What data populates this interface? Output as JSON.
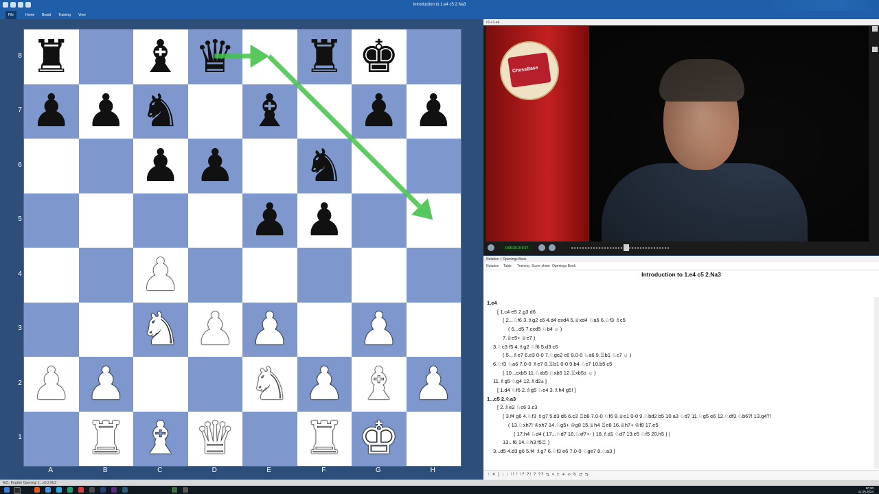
{
  "window": {
    "title": "Introduction to 1.e4 c5 2.Na3"
  },
  "menu": {
    "file": "File",
    "home": "Home",
    "board": "Board",
    "training": "Training",
    "view": "View"
  },
  "board": {
    "ranks": [
      "8",
      "7",
      "6",
      "5",
      "4",
      "3",
      "2",
      "1"
    ],
    "files": [
      "A",
      "B",
      "C",
      "D",
      "E",
      "F",
      "G",
      "H"
    ],
    "position": [
      [
        "r",
        "",
        "b",
        "q",
        "",
        "r",
        "k",
        ""
      ],
      [
        "p",
        "p",
        "n",
        "",
        "b",
        "",
        "p",
        "p"
      ],
      [
        "",
        "",
        "p",
        "p",
        "",
        "n",
        "",
        ""
      ],
      [
        "",
        "",
        "",
        "",
        "p",
        "p",
        "",
        ""
      ],
      [
        "",
        "",
        "P",
        "",
        "",
        "",
        "",
        ""
      ],
      [
        "",
        "",
        "N",
        "P",
        "P",
        "",
        "P",
        ""
      ],
      [
        "P",
        "P",
        "",
        "",
        "N",
        "P",
        "B",
        "P"
      ],
      [
        "",
        "R",
        "B",
        "Q",
        "",
        "R",
        "K",
        ""
      ]
    ],
    "arrow_color": "#44c24a",
    "arrows": [
      [
        "d8",
        "e8"
      ],
      [
        "e8",
        "h5"
      ]
    ]
  },
  "video": {
    "header": "c1-c1-e4",
    "timecode": "0:05:26.0/ 9:27",
    "logo_text": "ChessBase"
  },
  "notation": {
    "header": "Notation + Openings Book",
    "tabs": [
      "Notation",
      "Table",
      "Training",
      "Score sheet",
      "Openings Book"
    ],
    "game_title": "Introduction to 1.e4 c5 2.Na3",
    "lines": [
      {
        "text": "1.e4",
        "bold": true
      },
      {
        "text": "[ 1.c4  e5  2.g3  d6"
      },
      {
        "text": "( 2...♘f6  3.♗g2  c6  4.d4  exd4  5.♕xd4  ♘a6  6.♘f3  ♗c5"
      },
      {
        "text": "( 6...d5  7.cxd5  ♘b4  ☼ )"
      },
      {
        "text": "7.♕e5+  ♕e7 )"
      },
      {
        "text": "3.♘c3  f5  4.♗g2  ♘f6  5.d3  c6"
      },
      {
        "text": "( 5...♗e7  6.e3  0-0  7.♘ge2  c6  8.0-0  ♘a6  9.♖b1  ♘c7  ☼ )"
      },
      {
        "text": "6.♘f3  ♘a6  7.0-0  ♗e7  8.♖b1  0-0  9.b4  ♘c7  10.b5  c5"
      },
      {
        "text": "( 10...cxb5  11.♘xb5  ♘xb5  12.♖xb5±  ☼ )"
      },
      {
        "text": "11.♗g5  ♘g4  12.♗d2±  ]"
      },
      {
        "text": "[ 1.d4  ♘f6  2.♗g5  ♘e4  3.♗h4  g5! ]"
      },
      {
        "text": "1...c5  2.♘a3",
        "bold": true
      },
      {
        "text": "[ 2.♗e2  ♘c6  3.c3"
      },
      {
        "text": "( 3.f4  g6  4.♘f3  ♗g7  5.d3  d6  6.c3  ♖b8  7.0-0  ♘f6  8.♕e1  0-0  9.♘bd2  b5  10.a3  ♘d7  11.♘g5  e6  12.♘df3  ♘b6?!  13.g4?!"
      },
      {
        "text": "( 13.♘xh7!  ♔xh7  14.♘g5+  ♔g8  15.♕h4  ♖e8  16.♕h7+  ♔f8  17.e5"
      },
      {
        "text": "( 17.h4  ♘d4  ( 17...♘d7  18.♘xf7+- )  18.♗d1  ♘d7  19.e5  ♘f5  20.h5 ) )"
      },
      {
        "text": "13...f6  14.♘h3  f5♖ )"
      },
      {
        "text": "3...d5  4.d3  g6  5.f4  ♗g7  6.♘f3  e6  7.0-0  ♘ge7  8.♘a3 ]"
      }
    ],
    "toolbar": "↑ ✕ ] ↓ ↓ !! ! !? ?! ? ?? ⇆ = ± ∓ ∞ ↻ ⇄ ⇆"
  },
  "status": {
    "text": "A21: English Opening: 1...e5 2.Nc3"
  },
  "clock": {
    "time": "00:30",
    "date": "11.06.2024"
  }
}
